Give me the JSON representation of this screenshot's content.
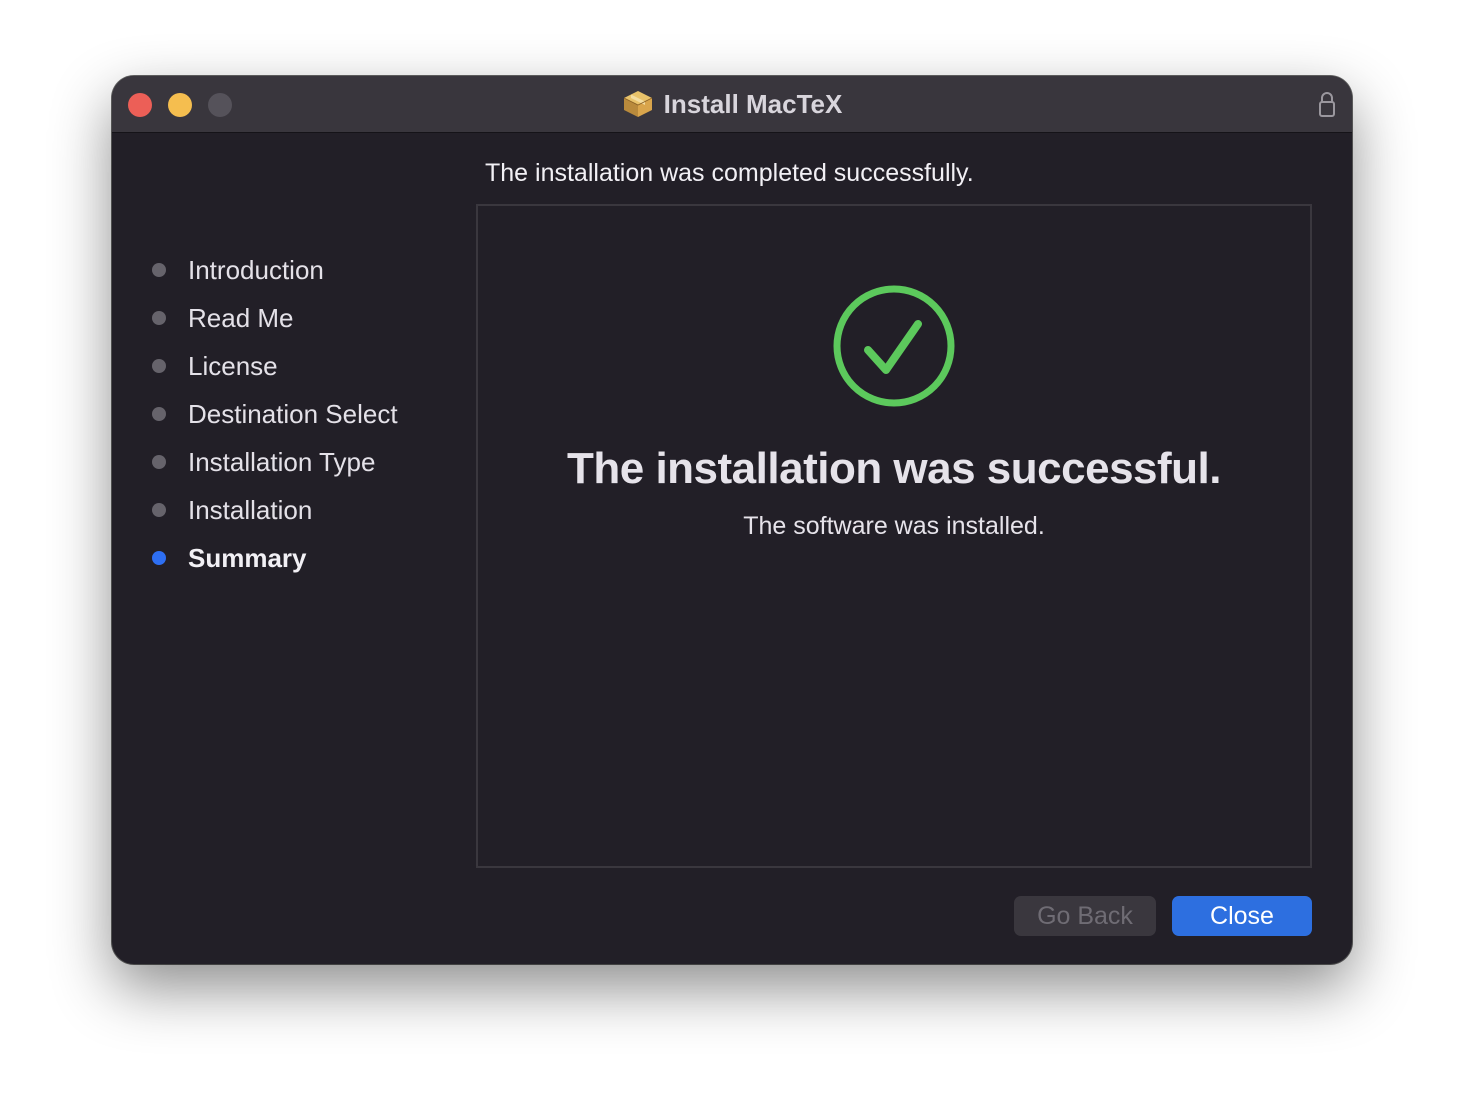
{
  "window": {
    "title": "Install MacTeX",
    "icons": {
      "app": "package-icon",
      "lock": "lock-icon"
    }
  },
  "header": {
    "subtitle": "The installation was completed successfully."
  },
  "sidebar": {
    "steps": [
      {
        "label": "Introduction",
        "active": false
      },
      {
        "label": "Read Me",
        "active": false
      },
      {
        "label": "License",
        "active": false
      },
      {
        "label": "Destination Select",
        "active": false
      },
      {
        "label": "Installation Type",
        "active": false
      },
      {
        "label": "Installation",
        "active": false
      },
      {
        "label": "Summary",
        "active": true
      }
    ]
  },
  "main": {
    "status_icon": "checkmark-circle-icon",
    "headline": "The installation was successful.",
    "message": "The software was installed."
  },
  "buttons": {
    "go_back": "Go Back",
    "close": "Close"
  },
  "colors": {
    "accent": "#2d6fe0",
    "success": "#5cc95c",
    "active_step": "#2e6ff3",
    "window_bg": "#221f27"
  }
}
